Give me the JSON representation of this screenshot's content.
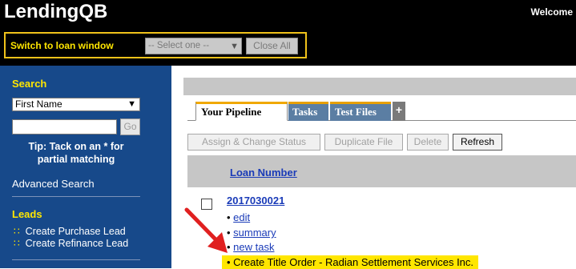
{
  "header": {
    "logo": "LendingQB",
    "welcome": "Welcome",
    "switch_label": "Switch to loan window",
    "loan_select_value": "-- Select one --",
    "close_all_label": "Close All"
  },
  "sidebar": {
    "search_heading": "Search",
    "search_field_selected": "First Name",
    "search_value": "",
    "go_label": "Go",
    "tip_line1": "Tip: Tack on an * for",
    "tip_line2": "partial matching",
    "advanced_search": "Advanced Search",
    "leads_heading": "Leads",
    "lead_items": [
      {
        "label": "Create Purchase Lead"
      },
      {
        "label": "Create Refinance Lead"
      }
    ]
  },
  "tabs": [
    {
      "label": "Your Pipeline"
    },
    {
      "label": "Tasks"
    },
    {
      "label": "Test Files"
    },
    {
      "label": "+"
    }
  ],
  "toolbar": {
    "assign_label": "Assign & Change Status",
    "duplicate_label": "Duplicate File",
    "delete_label": "Delete",
    "refresh_label": "Refresh"
  },
  "table": {
    "column_header": "Loan Number",
    "rows": [
      {
        "loan_number": "2017030021",
        "actions": [
          {
            "label": "edit"
          },
          {
            "label": "summary"
          },
          {
            "label": "new task"
          },
          {
            "label": "Create Title Order - Radian Settlement Services Inc."
          }
        ]
      }
    ]
  },
  "colors": {
    "header_bg": "#000000",
    "sidebar_bg": "#17498a",
    "accent_yellow": "#ffe600",
    "tab_blue": "#5b7ea3",
    "tab_orange": "#f0a800",
    "link_blue": "#1a3bb8",
    "annotation_arrow": "#e02020"
  },
  "icons": {
    "select_chevron": "chevron-down-icon",
    "lead_bullet": "square-bullet-icon",
    "annotation": "red-arrow-icon"
  }
}
